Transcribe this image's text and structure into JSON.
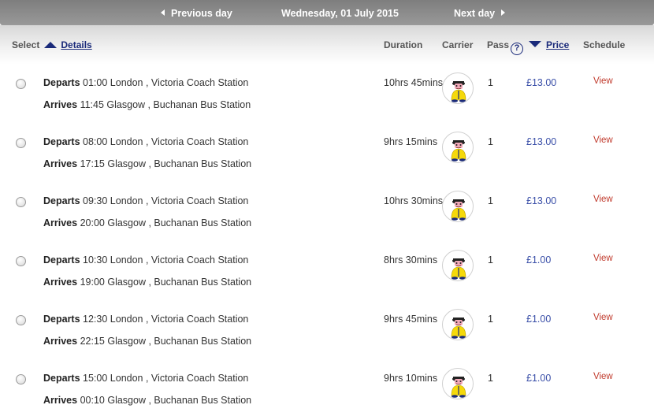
{
  "daybar": {
    "prev_label": "Previous day",
    "date": "Wednesday, 01 July 2015",
    "next_label": "Next day"
  },
  "header": {
    "select": "Select",
    "details": "Details",
    "duration": "Duration",
    "carrier": "Carrier",
    "pass": "Pass",
    "help": "?",
    "price": "Price",
    "schedule": "Schedule"
  },
  "labels": {
    "departs": "Departs",
    "arrives": "Arrives",
    "view": "View"
  },
  "carrier_icon": "megabus-mascot-icon",
  "colors": {
    "accent": "#1a2a7a",
    "price": "#3a4fa8",
    "view_link": "#c0392b",
    "mascot_jacket": "#f5d90a"
  },
  "journeys": [
    {
      "dep_time": "01:00",
      "dep_place": "London , Victoria Coach Station",
      "arr_time": "11:45",
      "arr_place": "Glasgow , Buchanan Bus Station",
      "duration": "10hrs 45mins",
      "pass": "1",
      "price": "£13.00"
    },
    {
      "dep_time": "08:00",
      "dep_place": "London , Victoria Coach Station",
      "arr_time": "17:15",
      "arr_place": "Glasgow , Buchanan Bus Station",
      "duration": "9hrs 15mins",
      "pass": "1",
      "price": "£13.00"
    },
    {
      "dep_time": "09:30",
      "dep_place": "London , Victoria Coach Station",
      "arr_time": "20:00",
      "arr_place": "Glasgow , Buchanan Bus Station",
      "duration": "10hrs 30mins",
      "pass": "1",
      "price": "£13.00"
    },
    {
      "dep_time": "10:30",
      "dep_place": "London , Victoria Coach Station",
      "arr_time": "19:00",
      "arr_place": "Glasgow , Buchanan Bus Station",
      "duration": "8hrs 30mins",
      "pass": "1",
      "price": "£1.00"
    },
    {
      "dep_time": "12:30",
      "dep_place": "London , Victoria Coach Station",
      "arr_time": "22:15",
      "arr_place": "Glasgow , Buchanan Bus Station",
      "duration": "9hrs 45mins",
      "pass": "1",
      "price": "£1.00"
    },
    {
      "dep_time": "15:00",
      "dep_place": "London , Victoria Coach Station",
      "arr_time": "00:10",
      "arr_place": "Glasgow , Buchanan Bus Station",
      "duration": "9hrs 10mins",
      "pass": "1",
      "price": "£1.00"
    }
  ]
}
